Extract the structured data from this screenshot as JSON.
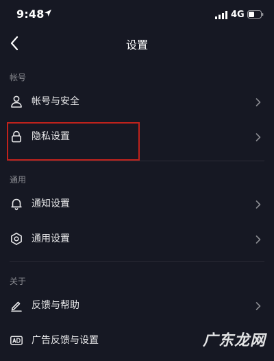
{
  "status_bar": {
    "time": "9:48",
    "network": "4G"
  },
  "nav": {
    "title": "设置"
  },
  "sections": [
    {
      "header": "帐号",
      "items": [
        {
          "label": "帐号与安全",
          "icon": "person-icon"
        },
        {
          "label": "隐私设置",
          "icon": "lock-icon",
          "highlighted": true
        }
      ]
    },
    {
      "header": "通用",
      "items": [
        {
          "label": "通知设置",
          "icon": "bell-icon"
        },
        {
          "label": "通用设置",
          "icon": "gear-icon"
        }
      ]
    },
    {
      "header": "关于",
      "items": [
        {
          "label": "反馈与帮助",
          "icon": "pencil-icon"
        },
        {
          "label": "广告反馈与设置",
          "icon": "ad-icon"
        }
      ]
    }
  ],
  "watermark": "广东龙网",
  "colors": {
    "background": "#161823",
    "text": "#e8e8ea",
    "section_header": "#8a8b91",
    "divider": "#2b2c37",
    "highlight": "#c0221c"
  }
}
